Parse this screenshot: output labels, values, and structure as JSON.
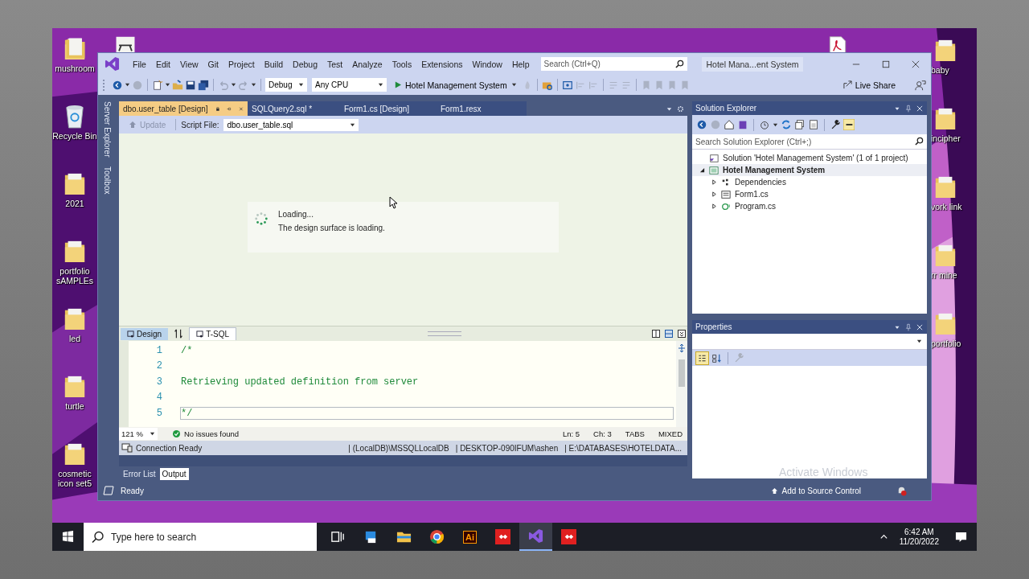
{
  "desktop": {
    "icons_left": [
      {
        "label": "mushroom",
        "kind": "folder"
      },
      {
        "label": "Recycle Bin",
        "kind": "bin"
      },
      {
        "label": "2021",
        "kind": "folder"
      },
      {
        "label": "portfolio sAMPLEs",
        "kind": "folder"
      },
      {
        "label": "led",
        "kind": "folder"
      },
      {
        "label": "turtle",
        "kind": "folder"
      },
      {
        "label": "cosmetic icon set5",
        "kind": "folder"
      }
    ],
    "icons_right": [
      {
        "label": "baby",
        "kind": "folder"
      },
      {
        "label": "incipher",
        "kind": "folder"
      },
      {
        "label": "vork link",
        "kind": "folder"
      },
      {
        "label": "rr mine",
        "kind": "folder"
      },
      {
        "label": "portfolio",
        "kind": "folder"
      }
    ]
  },
  "window": {
    "title": "Hotel Mana...ent System",
    "menu": [
      "File",
      "Edit",
      "View",
      "Git",
      "Project",
      "Build",
      "Debug",
      "Test",
      "Analyze",
      "Tools",
      "Extensions",
      "Window",
      "Help"
    ],
    "search": {
      "placeholder": "Search (Ctrl+Q)"
    }
  },
  "toolbar": {
    "configuration": "Debug",
    "platform": "Any CPU",
    "run_target": "Hotel Management System",
    "live_share": "Live Share"
  },
  "side_tabs": [
    "Server Explorer",
    "Toolbox"
  ],
  "document_tabs": [
    {
      "label": "dbo.user_table [Design]",
      "selected": true
    },
    {
      "label": "SQLQuery2.sql *",
      "selected": false
    },
    {
      "label": "Form1.cs [Design]",
      "selected": false
    },
    {
      "label": "Form1.resx",
      "selected": false
    }
  ],
  "designer": {
    "update": {
      "label": "Update",
      "disabled": true
    },
    "script_file_label": "Script File:",
    "script_file": "dbo.user_table.sql",
    "loading_title": "Loading...",
    "loading_message": "The design surface is loading."
  },
  "pane_tabs": [
    {
      "label": "Design",
      "selected": false
    },
    {
      "label": "T-SQL",
      "selected": true
    }
  ],
  "code_lines": [
    {
      "number": "1",
      "text": "/*",
      "current": false
    },
    {
      "number": "2",
      "current": false
    },
    {
      "number": "3",
      "text": "Retrieving updated definition from server",
      "current": false
    },
    {
      "number": "4",
      "current": false
    },
    {
      "number": "5",
      "text": "*/",
      "current": true
    }
  ],
  "editor_status": {
    "zoom": "121 %",
    "issues": "No issues found",
    "line": "Ln: 5",
    "column": "Ch: 3",
    "indent": "TABS",
    "line_endings": "MIXED"
  },
  "connection_bar": {
    "status": "Connection Ready",
    "items": [
      "| (LocalDB)\\MSSQLLocalDB",
      "| DESKTOP-090IFUM\\ashen",
      "| E:\\DATABASES\\HOTELDATA..."
    ]
  },
  "bottom_tabs": [
    {
      "label": "Error List",
      "selected": false
    },
    {
      "label": "Output",
      "selected": true
    }
  ],
  "status_bar": {
    "text": "Ready",
    "source_control": "Add to Source Control"
  },
  "solution_explorer": {
    "title": "Solution Explorer",
    "search": {
      "placeholder": "Search Solution Explorer (Ctrl+;)"
    },
    "tree": [
      {
        "label": "Solution 'Hotel Management System' (1 of 1 project)",
        "kind": "solution",
        "children": [
          {
            "label": "Hotel Management System",
            "kind": "project",
            "expanded": true,
            "selected": true,
            "children": [
              {
                "label": "Dependencies",
                "kind": "dependencies",
                "expanded": false,
                "selected": false
              },
              {
                "label": "Form1.cs",
                "kind": "form",
                "expanded": false,
                "selected": false
              },
              {
                "label": "Program.cs",
                "kind": "csharp",
                "expanded": false,
                "selected": false
              }
            ]
          }
        ]
      }
    ]
  },
  "properties": {
    "title": "Properties",
    "sort_modes": [
      {
        "kind": "categorized",
        "selected": true
      },
      {
        "kind": "alphabetical",
        "selected": false
      }
    ]
  },
  "activation_notice": "Activate Windows",
  "taskbar": {
    "search": {
      "placeholder": "Type here to search"
    },
    "apps": [
      {
        "kind": "task-view",
        "active": false
      },
      {
        "kind": "app",
        "active": false
      },
      {
        "kind": "folder",
        "active": false
      },
      {
        "kind": "browser",
        "active": false
      },
      {
        "kind": "illustrator",
        "label": "Ai",
        "active": false
      },
      {
        "kind": "remote",
        "active": false
      },
      {
        "kind": "studio",
        "active": true
      },
      {
        "kind": "remote",
        "active": false
      }
    ],
    "time": "6:42 AM",
    "date": "11/20/2022"
  }
}
